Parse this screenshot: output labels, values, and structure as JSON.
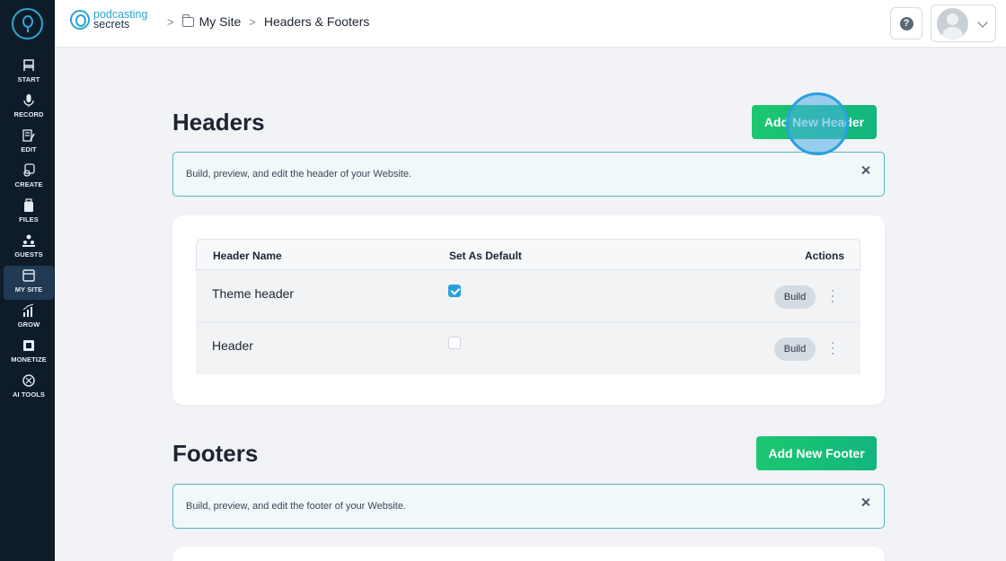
{
  "sidebar": {
    "items": [
      {
        "label": "START",
        "icon": "chair-icon"
      },
      {
        "label": "RECORD",
        "icon": "microphone-icon"
      },
      {
        "label": "EDIT",
        "icon": "edit-icon"
      },
      {
        "label": "CREATE",
        "icon": "create-icon"
      },
      {
        "label": "FILES",
        "icon": "files-icon"
      },
      {
        "label": "GUESTS",
        "icon": "guests-icon"
      },
      {
        "label": "MY SITE",
        "icon": "site-icon",
        "active": true
      },
      {
        "label": "GROW",
        "icon": "chart-icon"
      },
      {
        "label": "MONETIZE",
        "icon": "monetize-icon"
      },
      {
        "label": "AI TOOLS",
        "icon": "ai-icon"
      }
    ]
  },
  "brand": {
    "line1": "podcasting",
    "line2": "secrets"
  },
  "breadcrumb": {
    "sep": ">",
    "site": "My Site",
    "page": "Headers & Footers"
  },
  "help": {
    "label": "?"
  },
  "headers": {
    "title": "Headers",
    "add_label": "Add New Header",
    "info": "Build, preview, and edit the header of your Website.",
    "columns": {
      "name": "Header Name",
      "default": "Set As Default",
      "actions": "Actions"
    },
    "rows": [
      {
        "name": "Theme header",
        "default": true,
        "action": "Build"
      },
      {
        "name": "Header",
        "default": false,
        "action": "Build"
      }
    ]
  },
  "footers": {
    "title": "Footers",
    "add_label": "Add New Footer",
    "info": "Build, preview, and edit the footer of your Website."
  },
  "colors": {
    "accent": "#1dc76f",
    "sidebar": "#0e1c2a",
    "info_border": "#53b6c2",
    "checkbox": "#2b9fdb"
  }
}
